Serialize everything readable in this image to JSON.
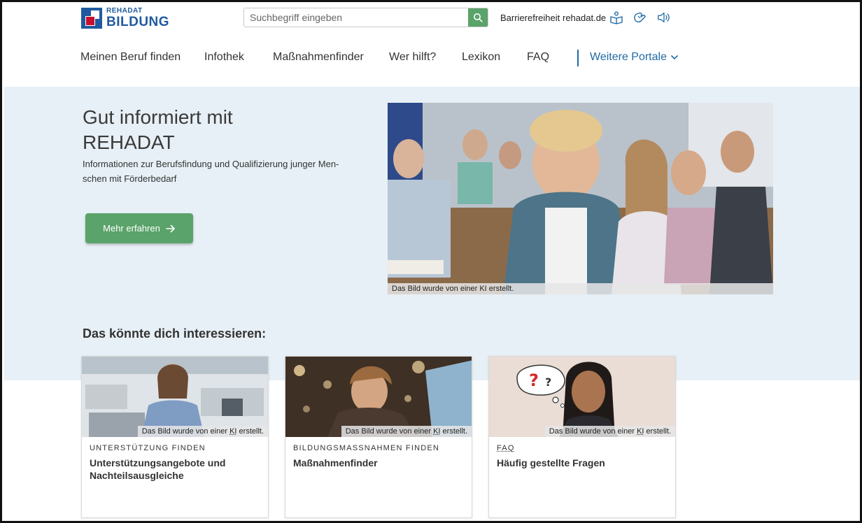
{
  "header": {
    "logo": {
      "top": "REHADAT",
      "bottom": "BILDUNG"
    },
    "search": {
      "placeholder": "Suchbegriff eingeben"
    },
    "utility": {
      "accessibility": "Barrierefreiheit",
      "site_link": "rehadat.de"
    },
    "icons": [
      "easy-language-icon",
      "sign-language-icon",
      "read-aloud-icon"
    ]
  },
  "nav": {
    "items": [
      "Meinen Beruf finden",
      "Infothek",
      "Maßnahmenfinder",
      "Wer hilft?",
      "Lexikon",
      "FAQ"
    ],
    "more": "Weitere Portale"
  },
  "hero": {
    "title_line1": "Gut informiert mit",
    "title_line2": "REHADAT",
    "text": "Informationen zur Berufsfindung und Qualifizierung junger Men-schen mit Förderbedarf",
    "button": "Mehr erfahren",
    "image_caption": "Das Bild wurde von einer KI erstellt."
  },
  "section": {
    "title": "Das könnte dich interessieren:"
  },
  "cards": [
    {
      "kicker": "UNTERSTÜTZUNG FINDEN",
      "title": "Unterstützungsangebote und Nachteilsausgleiche",
      "caption_pre": "Das Bild wurde von einer ",
      "caption_abbr": "KI",
      "caption_post": " erstellt."
    },
    {
      "kicker": "BILDUNGSMASSNAHMEN FINDEN",
      "title": "Maßnahmenfinder",
      "caption_pre": "Das Bild wurde von einer ",
      "caption_abbr": "KI",
      "caption_post": " erstellt."
    },
    {
      "kicker": "FAQ",
      "title": "Häufig gestellte Fragen",
      "caption_pre": "Das Bild wurde von einer ",
      "caption_abbr": "KI",
      "caption_post": " erstellt."
    }
  ],
  "colors": {
    "brand_blue": "#1f5aa0",
    "accent_green": "#5aa36a",
    "hero_bg": "#e7f0f6",
    "nav_blue": "#1f6aa5"
  }
}
